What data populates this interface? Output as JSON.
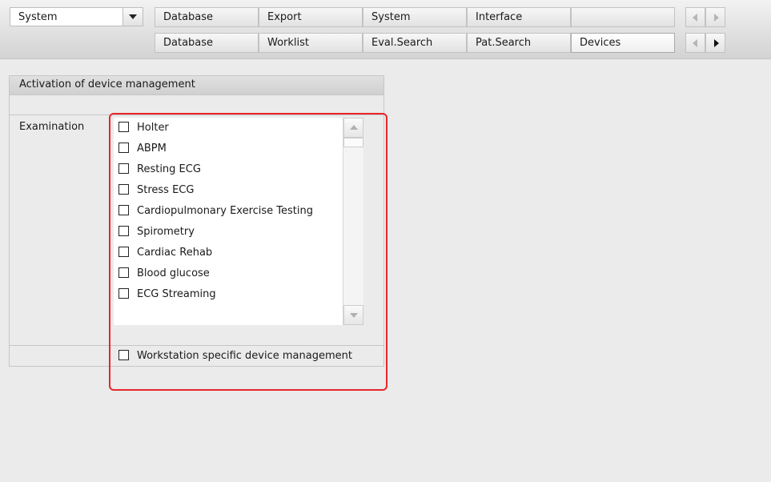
{
  "module_select": {
    "value": "System"
  },
  "tabs_row1": [
    "Database",
    "Export",
    "System",
    "Interface",
    ""
  ],
  "tabs_row2": [
    "Database",
    "Worklist",
    "Eval.Search",
    "Pat.Search",
    "Devices"
  ],
  "active_tab": "Devices",
  "panel": {
    "title": "Activation of device management",
    "examination_label": "Examination",
    "examinations": [
      "Holter",
      "ABPM",
      "Resting ECG",
      "Stress ECG",
      "Cardiopulmonary Exercise Testing",
      "Spirometry",
      "Cardiac Rehab",
      "Blood glucose",
      "ECG Streaming"
    ],
    "workstation_option": "Workstation specific device management"
  },
  "colors": {
    "highlight": "#e8262a"
  },
  "icons": [
    "chevron-down-icon",
    "arrow-left-icon",
    "arrow-right-icon",
    "scroll-up-icon",
    "scroll-down-icon"
  ]
}
